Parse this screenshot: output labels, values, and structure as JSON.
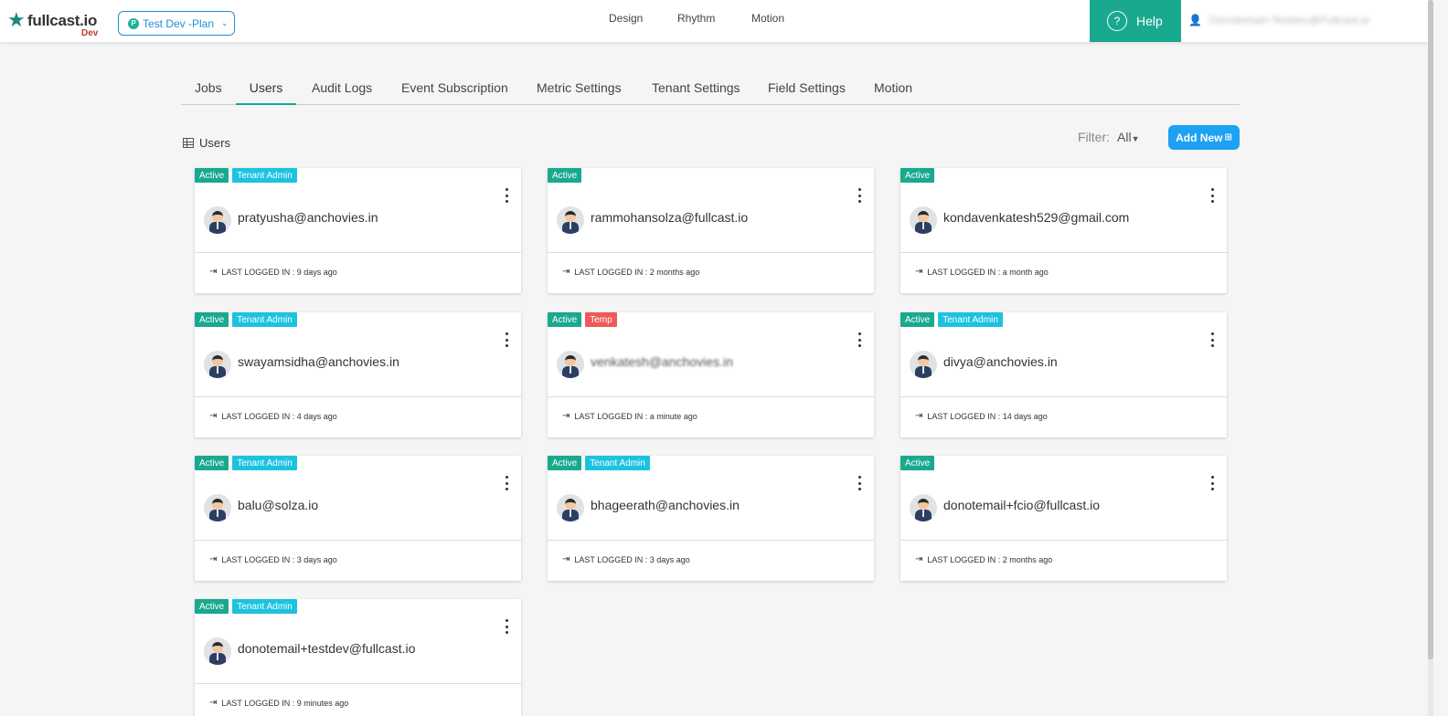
{
  "header": {
    "logo_text": "fullcast.io",
    "env_label": "Dev",
    "plan_selector": {
      "icon_letter": "P",
      "label": "Test Dev -Plan"
    },
    "nav": [
      "Design",
      "Rhythm",
      "Motion"
    ],
    "help_label": "Help",
    "user_email": "Donotemail+Testdev@Fullcast.io"
  },
  "tabs": [
    {
      "label": "Jobs",
      "active": false
    },
    {
      "label": "Users",
      "active": true
    },
    {
      "label": "Audit Logs",
      "active": false
    },
    {
      "label": "Event Subscription",
      "active": false
    },
    {
      "label": "Metric Settings",
      "active": false
    },
    {
      "label": "Tenant Settings",
      "active": false
    },
    {
      "label": "Field Settings",
      "active": false
    },
    {
      "label": "Motion",
      "active": false
    }
  ],
  "section": {
    "title": "Users",
    "filter_label": "Filter:",
    "filter_value": "All",
    "add_new_label": "Add New"
  },
  "last_logged_prefix": "LAST LOGGED IN : ",
  "users": [
    {
      "email": "pratyusha@anchovies.in",
      "badges": [
        "Active",
        "Tenant Admin"
      ],
      "last_logged": "9 days ago"
    },
    {
      "email": "rammohansolza@fullcast.io",
      "badges": [
        "Active"
      ],
      "last_logged": "2 months ago"
    },
    {
      "email": "kondavenkatesh529@gmail.com",
      "badges": [
        "Active"
      ],
      "last_logged": "a month ago"
    },
    {
      "email": "swayamsidha@anchovies.in",
      "badges": [
        "Active",
        "Tenant Admin"
      ],
      "last_logged": "4 days ago"
    },
    {
      "email": "venkatesh@anchovies.in",
      "badges": [
        "Active",
        "Temp"
      ],
      "last_logged": "a minute ago",
      "blurred": true
    },
    {
      "email": "divya@anchovies.in",
      "badges": [
        "Active",
        "Tenant Admin"
      ],
      "last_logged": "14 days ago"
    },
    {
      "email": "balu@solza.io",
      "badges": [
        "Active",
        "Tenant Admin"
      ],
      "last_logged": "3 days ago"
    },
    {
      "email": "bhageerath@anchovies.in",
      "badges": [
        "Active",
        "Tenant Admin"
      ],
      "last_logged": "3 days ago"
    },
    {
      "email": "donotemail+fcio@fullcast.io",
      "badges": [
        "Active"
      ],
      "last_logged": "2 months ago"
    },
    {
      "email": "donotemail+testdev@fullcast.io",
      "badges": [
        "Active",
        "Tenant Admin"
      ],
      "last_logged": "9 minutes ago"
    }
  ],
  "colors": {
    "accent": "#19a98f",
    "primary_button": "#1da1f2",
    "badge_active": "#19a98f",
    "badge_admin": "#1cc3e0",
    "badge_temp": "#ee5a5a"
  }
}
